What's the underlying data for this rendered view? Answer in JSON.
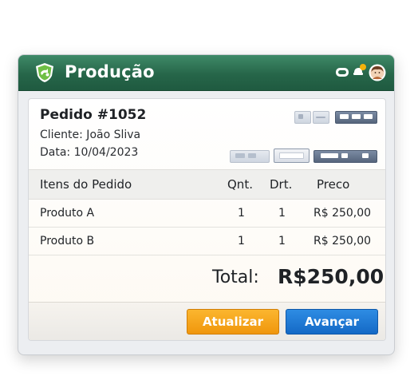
{
  "window": {
    "title": "Produção",
    "icons": [
      "app-shield-icon",
      "chat-icon",
      "notification-icon",
      "user-avatar-icon"
    ]
  },
  "order": {
    "title": "Pedido #1052",
    "client": "Cliente: João Sliva",
    "date": "Data: 10/04/2023"
  },
  "table": {
    "headers": {
      "item": "Itens do Pedido",
      "qty": "Qnt.",
      "drt": "Drt.",
      "price": "Preco"
    },
    "rows": [
      {
        "name": "Produto A",
        "qty": "1",
        "drt": "1",
        "price": "R$ 250,00"
      },
      {
        "name": "Produto B",
        "qty": "1",
        "drt": "1",
        "price": "R$ 250,00"
      }
    ]
  },
  "summary": {
    "total_label": "Total:",
    "total_value": "R$250,00"
  },
  "actions": {
    "update_label": "Atualizar",
    "next_label": "Avançar"
  },
  "colors": {
    "titlebar": "#266649",
    "update_button": "#f4a31c",
    "next_button": "#1f7bd6"
  }
}
